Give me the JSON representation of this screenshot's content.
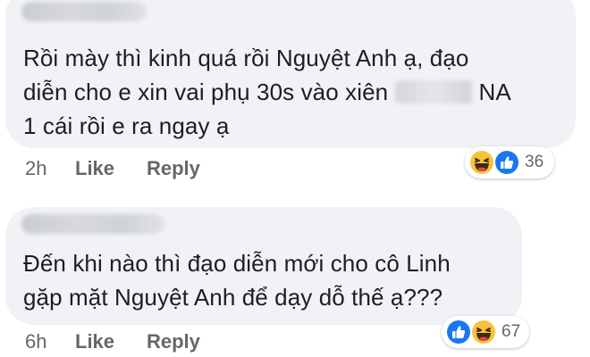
{
  "comments": [
    {
      "text_line1": "Rồi mày thì kinh quá rồi Nguyệt Anh ạ, đạo",
      "text_line2_a": "diễn cho e xin vai phụ 30s vào xiên",
      "text_line2_b": "NA",
      "text_line3": "1 cái rồi e ra ngay ạ",
      "time": "2h",
      "like_label": "Like",
      "reply_label": "Reply",
      "reactions": [
        "haha-icon",
        "like-icon"
      ],
      "reaction_count": "36"
    },
    {
      "text_line1": "Đến khi nào thì đạo diễn mới cho cô Linh",
      "text_line2": "gặp mặt Nguyệt Anh để dạy dỗ thế ạ???",
      "time": "6h",
      "like_label": "Like",
      "reply_label": "Reply",
      "reactions": [
        "like-icon",
        "haha-icon"
      ],
      "reaction_count": "67"
    }
  ],
  "colors": {
    "bubble": "#f0f2f5",
    "text": "#1c1e21",
    "meta": "#65676b",
    "like_blue": "#1877f2",
    "haha_yellow": "#f7c33b"
  }
}
